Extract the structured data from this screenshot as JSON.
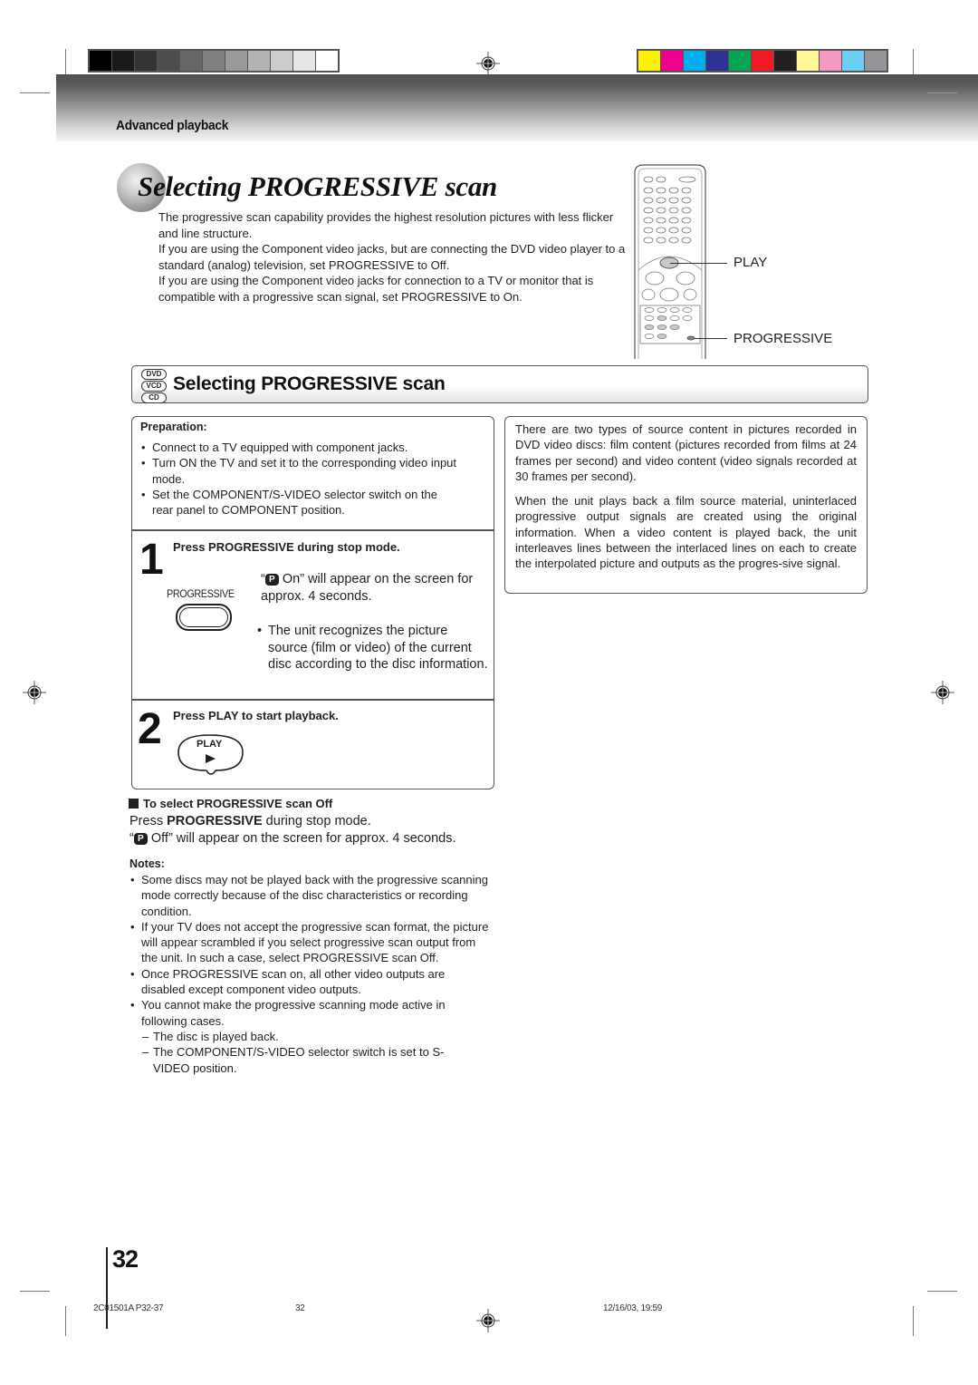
{
  "color_bars": {
    "grayscale": [
      "#000000",
      "#1a1a1a",
      "#333333",
      "#4d4d4d",
      "#666666",
      "#808080",
      "#999999",
      "#b3b3b3",
      "#cccccc",
      "#e6e6e6",
      "#ffffff"
    ],
    "colors": [
      "#fff200",
      "#ec008c",
      "#00aeef",
      "#2e3192",
      "#00a651",
      "#ed1c24",
      "#231f20",
      "#fff799",
      "#f49ac1",
      "#6dcff6",
      "#939598"
    ]
  },
  "header": {
    "section_label": "Advanced playback"
  },
  "title": "Selecting PROGRESSIVE scan",
  "intro": [
    "The progressive scan capability provides the highest resolution pictures with less flicker and line structure.",
    "If you are using the Component video jacks, but are connecting the DVD video player to a standard (analog) television, set PROGRESSIVE to Off.",
    "If you are using the Component video jacks for connection to a TV or monitor that is compatible with a progressive scan signal, set PROGRESSIVE to On."
  ],
  "remote": {
    "play_label": "PLAY",
    "progressive_label": "PROGRESSIVE"
  },
  "section": {
    "disc_badges": [
      "DVD",
      "VCD",
      "CD"
    ],
    "title": "Selecting PROGRESSIVE scan"
  },
  "preparation": {
    "title": "Preparation:",
    "items": [
      "Connect to a TV equipped with component jacks.",
      "Turn ON the TV and set it to the corresponding video input mode.",
      "Set the COMPONENT/S-VIDEO selector switch on the rear panel to COMPONENT position."
    ]
  },
  "steps": [
    {
      "number": "1",
      "heading": "Press PROGRESSIVE during stop mode.",
      "button_label": "PROGRESSIVE",
      "badge": "P",
      "message_pre": "“",
      "message_post": " On” will appear on the screen for approx. 4 seconds.",
      "bullet": "The unit recognizes the picture source (film or video) of the current disc according to the disc information."
    },
    {
      "number": "2",
      "heading": "Press PLAY to start playback.",
      "button_label": "PLAY",
      "button_glyph": "►"
    }
  ],
  "info": {
    "para1": "There are two types of source content in pictures recorded in DVD video discs: film content (pictures recorded from films at 24 frames per second) and video content (video signals recorded at 30 frames per second).",
    "para2": "When the unit plays back a film source material, uninterlaced progressive output signals are created using the original information. When a video content is played back, the unit interleaves lines between the interlaced lines on each to create the interpolated picture and outputs as the progres-sive signal."
  },
  "scan_off": {
    "title": "To select PROGRESSIVE scan Off",
    "line1_pre": "Press ",
    "line1_bold": "PROGRESSIVE",
    "line1_post": " during stop mode.",
    "badge": "P",
    "line2_pre": "“",
    "line2_post": " Off” will appear on the screen for approx. 4 seconds."
  },
  "notes": {
    "title": "Notes:",
    "items": [
      "Some discs may not be played back with the progressive scanning mode correctly because of the disc characteristics or recording condition.",
      "If your TV does not accept the progressive scan format, the picture will appear scrambled if you select progressive scan output from the unit. In such a case, select PROGRESSIVE scan Off.",
      "Once PROGRESSIVE scan on, all other video outputs are disabled except component video outputs.",
      "You cannot make the progressive scanning mode active in following cases."
    ],
    "sub_items": [
      "The disc is played back.",
      "The COMPONENT/S-VIDEO selector switch is set to S-VIDEO position."
    ]
  },
  "page_number": "32",
  "footer": {
    "doc_code": "2C01501A P32-37",
    "page": "32",
    "timestamp": "12/16/03, 19:59"
  }
}
